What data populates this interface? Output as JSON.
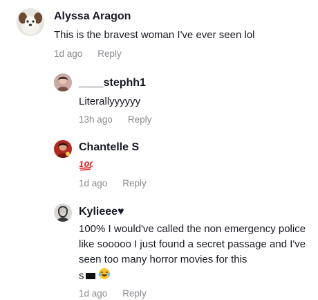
{
  "comments": [
    {
      "username": "Alyssa Aragon",
      "text": "This is the bravest woman I've ever seen lol",
      "time": "1d ago",
      "reply_label": "Reply",
      "avatar_icon": "dog-avatar-icon"
    },
    {
      "username": "____stephh1",
      "text": "Literallyyyyyy",
      "time": "13h ago",
      "reply_label": "Reply",
      "avatar_icon": "person-avatar-icon"
    },
    {
      "username": "Chantelle S",
      "emoji": "hundred-points-icon",
      "time": "1d ago",
      "reply_label": "Reply",
      "avatar_icon": "person-red-avatar-icon"
    },
    {
      "username": "Kylieee♥",
      "text": "100% I would've called the non emergency police like sooooo I just found a secret passage and I've seen too many horror movies for this",
      "text_tail": "s",
      "time": "1d ago",
      "reply_label": "Reply",
      "avatar_icon": "person-dark-avatar-icon"
    }
  ]
}
